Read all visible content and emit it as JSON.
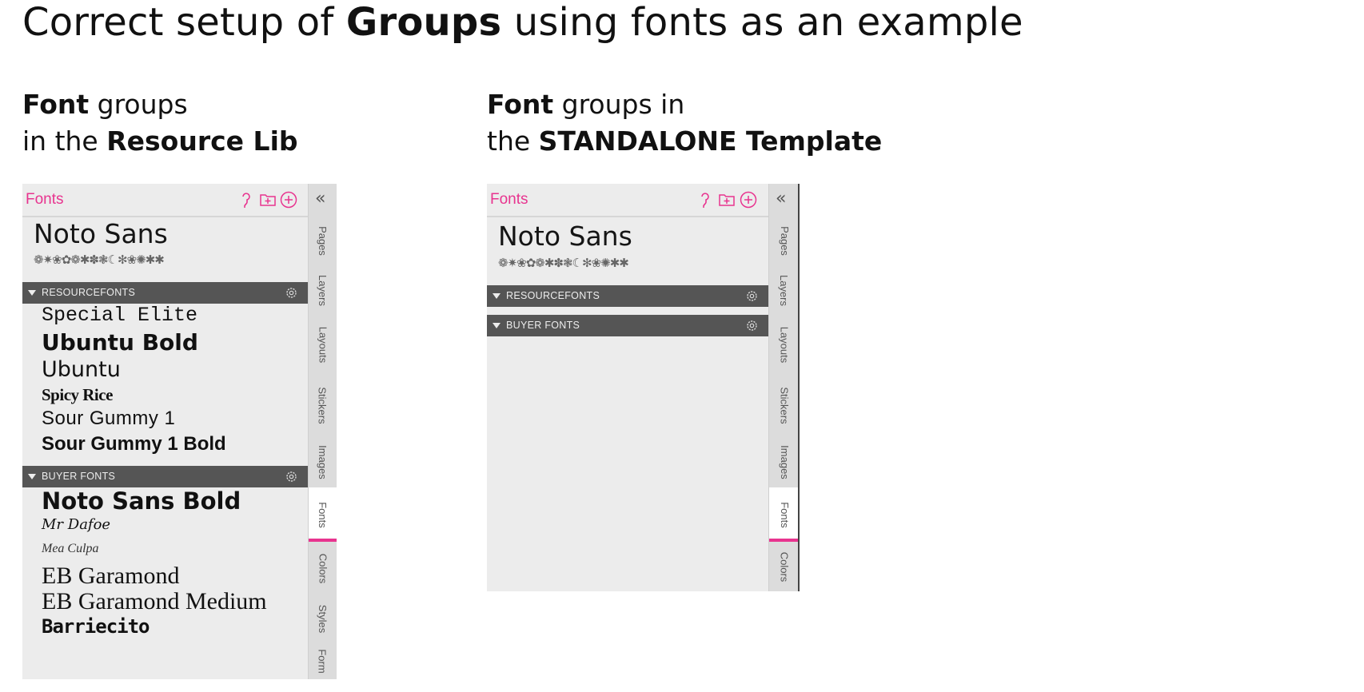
{
  "heading": {
    "part1": "Correct setup of ",
    "bold": "Groups",
    "part2": " using fonts as an example"
  },
  "left_caption": {
    "line1_bold": "Font",
    "line1_rest": " groups",
    "line2_rest": "in the ",
    "line2_bold": "Resource Lib"
  },
  "right_caption": {
    "line1_bold": "Font",
    "line1_rest": " groups in",
    "line2_rest": "the ",
    "line2_bold": "STANDALONE Template"
  },
  "colors": {
    "accent": "#e8348f",
    "group_bar": "#555555",
    "panel_bg": "#ececec"
  },
  "panels": {
    "resource": {
      "title": "Fonts",
      "featured_font": "Noto Sans",
      "glyph_sample": "❁✷❀✿❁✱✽❃☾✻❀✺✱✱",
      "groups": [
        {
          "name": "RESOURCEFONTS",
          "fonts": [
            "Special Elite",
            "Ubuntu Bold",
            "Ubuntu",
            "Spicy Rice",
            "Sour Gummy 1",
            "Sour Gummy 1 Bold"
          ]
        },
        {
          "name": "BUYER FONTS",
          "fonts": [
            "Noto Sans Bold",
            "Mr Dafoe",
            "Mea Culpa",
            "EB Garamond",
            "EB Garamond Medium",
            "Barriecito"
          ]
        }
      ],
      "tabs": [
        "Pages",
        "Layers",
        "Layouts",
        "Stickers",
        "Images",
        "Fonts",
        "Colors",
        "Styles",
        "Form"
      ],
      "active_tab": "Fonts"
    },
    "standalone": {
      "title": "Fonts",
      "featured_font": "Noto Sans",
      "glyph_sample": "❁✷❀✿❁✱✽❃☾✻❀✺✱✱",
      "groups": [
        {
          "name": "RESOURCEFONTS"
        },
        {
          "name": "BUYER FONTS"
        }
      ],
      "tabs": [
        "Pages",
        "Layers",
        "Layouts",
        "Stickers",
        "Images",
        "Fonts",
        "Colors"
      ],
      "active_tab": "Fonts"
    }
  },
  "icons": {
    "help": "question-icon",
    "new_folder": "folder-plus-icon",
    "add": "plus-circle-icon",
    "collapse": "double-chevron-left-icon",
    "group_toggle": "triangle-down-icon",
    "group_settings": "gear-icon"
  }
}
